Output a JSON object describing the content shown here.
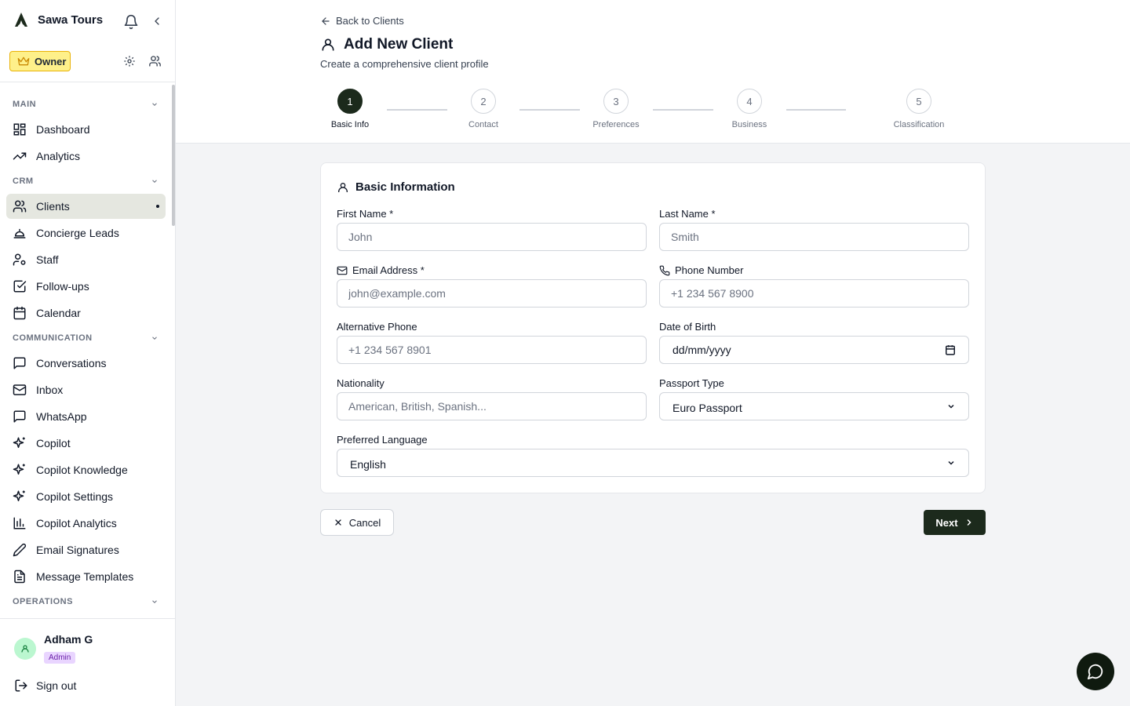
{
  "sidebar": {
    "brand": "Sawa Tours",
    "role_badge": "Owner",
    "sections": {
      "main": "MAIN",
      "crm": "CRM",
      "communication": "COMMUNICATION",
      "operations": "OPERATIONS"
    },
    "items": [
      {
        "label": "Dashboard",
        "icon": "dashboard-icon"
      },
      {
        "label": "Analytics",
        "icon": "trending-up-icon"
      },
      {
        "label": "Clients",
        "icon": "users-icon",
        "active": true
      },
      {
        "label": "Concierge Leads",
        "icon": "concierge-bell-icon"
      },
      {
        "label": "Staff",
        "icon": "user-cog-icon"
      },
      {
        "label": "Follow-ups",
        "icon": "check-square-icon"
      },
      {
        "label": "Calendar",
        "icon": "calendar-icon"
      },
      {
        "label": "Conversations",
        "icon": "message-square-icon"
      },
      {
        "label": "Inbox",
        "icon": "mail-icon"
      },
      {
        "label": "WhatsApp",
        "icon": "message-square-icon"
      },
      {
        "label": "Copilot",
        "icon": "sparkles-icon"
      },
      {
        "label": "Copilot Knowledge",
        "icon": "sparkles-icon"
      },
      {
        "label": "Copilot Settings",
        "icon": "sparkles-icon"
      },
      {
        "label": "Copilot Analytics",
        "icon": "bar-chart-icon"
      },
      {
        "label": "Email Signatures",
        "icon": "pen-icon"
      },
      {
        "label": "Message Templates",
        "icon": "file-text-icon"
      }
    ],
    "user": {
      "name": "Adham G",
      "role": "Admin"
    },
    "sign_out": "Sign out"
  },
  "header": {
    "back_link": "Back to Clients",
    "title": "Add New Client",
    "subtitle": "Create a comprehensive client profile",
    "steps": [
      {
        "number": "1",
        "label": "Basic Info",
        "active": true
      },
      {
        "number": "2",
        "label": "Contact"
      },
      {
        "number": "3",
        "label": "Preferences"
      },
      {
        "number": "4",
        "label": "Business"
      },
      {
        "number": "5",
        "label": "Classification"
      }
    ]
  },
  "form": {
    "section_title": "Basic Information",
    "first_name": {
      "label": "First Name *",
      "placeholder": "John"
    },
    "last_name": {
      "label": "Last Name *",
      "placeholder": "Smith"
    },
    "email": {
      "label": "Email Address *",
      "placeholder": "john@example.com"
    },
    "phone": {
      "label": "Phone Number",
      "placeholder": "+1 234 567 8900"
    },
    "alt_phone": {
      "label": "Alternative Phone",
      "placeholder": "+1 234 567 8901"
    },
    "dob": {
      "label": "Date of Birth",
      "placeholder": "dd/mm/yyyy"
    },
    "nationality": {
      "label": "Nationality",
      "placeholder": "American, British, Spanish..."
    },
    "passport_type": {
      "label": "Passport Type",
      "value": "Euro Passport"
    },
    "language": {
      "label": "Preferred Language",
      "value": "English"
    }
  },
  "actions": {
    "cancel": "Cancel",
    "next": "Next"
  },
  "colors": {
    "primary": "#1c2a1c",
    "owner_badge": "#fef08a",
    "admin_badge": "#e9d5ff",
    "active_nav": "#e5e7e0"
  }
}
